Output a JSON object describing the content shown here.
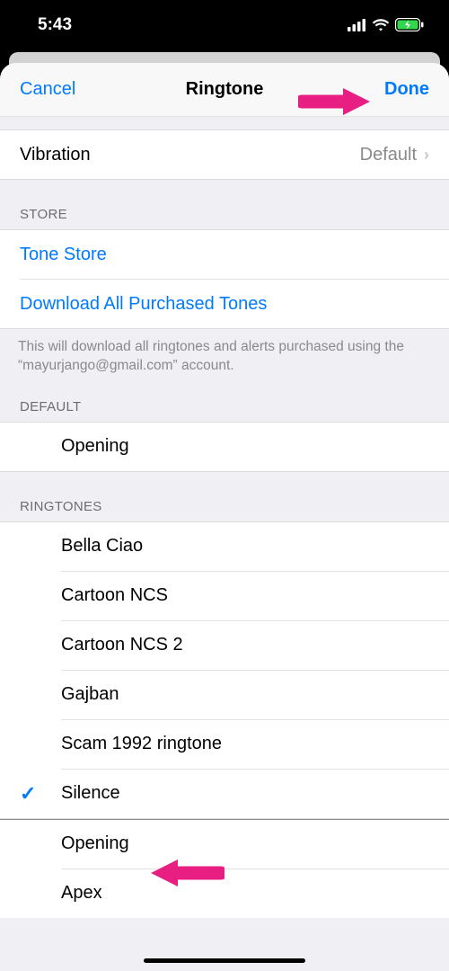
{
  "statusBar": {
    "time": "5:43"
  },
  "nav": {
    "cancel": "Cancel",
    "title": "Ringtone",
    "done": "Done"
  },
  "vibration": {
    "label": "Vibration",
    "value": "Default"
  },
  "storeHeader": "STORE",
  "store": {
    "toneStore": "Tone Store",
    "downloadAll": "Download All Purchased Tones"
  },
  "storeFooter": "This will download all ringtones and alerts purchased using the “mayurjango@gmail.com” account.",
  "defaultHeader": "DEFAULT",
  "defaultTone": "Opening",
  "ringtonesHeader": "RINGTONES",
  "ringtones": [
    "Bella Ciao",
    "Cartoon NCS",
    "Cartoon NCS 2",
    "Gajban",
    "Scam 1992 ringtone",
    "Silence"
  ],
  "selectedRingtone": "Silence",
  "moreTones": [
    "Opening",
    "Apex"
  ]
}
